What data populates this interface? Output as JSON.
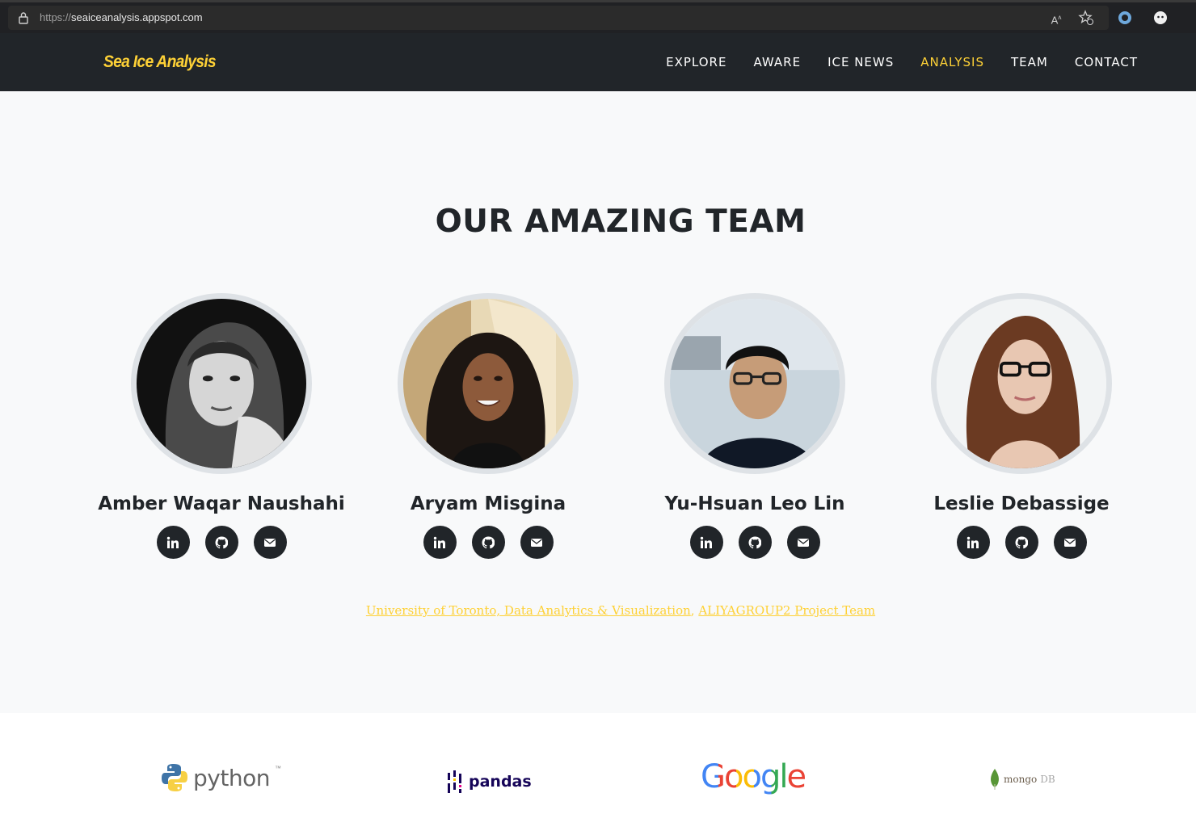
{
  "browser": {
    "url_protocol": "https://",
    "url_host": "seaiceanalysis.appspot.com"
  },
  "brand": "Sea Ice Analysis",
  "nav": {
    "items": [
      {
        "label": "EXPLORE",
        "active": false
      },
      {
        "label": "AWARE",
        "active": false
      },
      {
        "label": "ICE NEWS",
        "active": false
      },
      {
        "label": "ANALYSIS",
        "active": true
      },
      {
        "label": "TEAM",
        "active": false
      },
      {
        "label": "CONTACT",
        "active": false
      }
    ]
  },
  "team": {
    "title": "OUR AMAZING TEAM",
    "members": [
      {
        "name": "Amber Waqar Naushahi"
      },
      {
        "name": "Aryam Misgina"
      },
      {
        "name": "Yu-Hsuan Leo Lin"
      },
      {
        "name": "Leslie Debassige"
      }
    ],
    "social_icons": [
      "linkedin-icon",
      "github-icon",
      "envelope-icon"
    ]
  },
  "credit": {
    "link1": "University of Toronto, Data Analytics & Visualization",
    "separator": ", ",
    "link2": "ALIYAGROUP2 Project Team"
  },
  "logos": {
    "python": "python",
    "python_tm": "™",
    "pandas": "pandas",
    "google": "Google",
    "mongo_a": "mongo",
    "mongo_b": "DB"
  },
  "colors": {
    "accent": "#fed136",
    "nav_bg": "#212529",
    "page_bg": "#f8f9fa"
  }
}
